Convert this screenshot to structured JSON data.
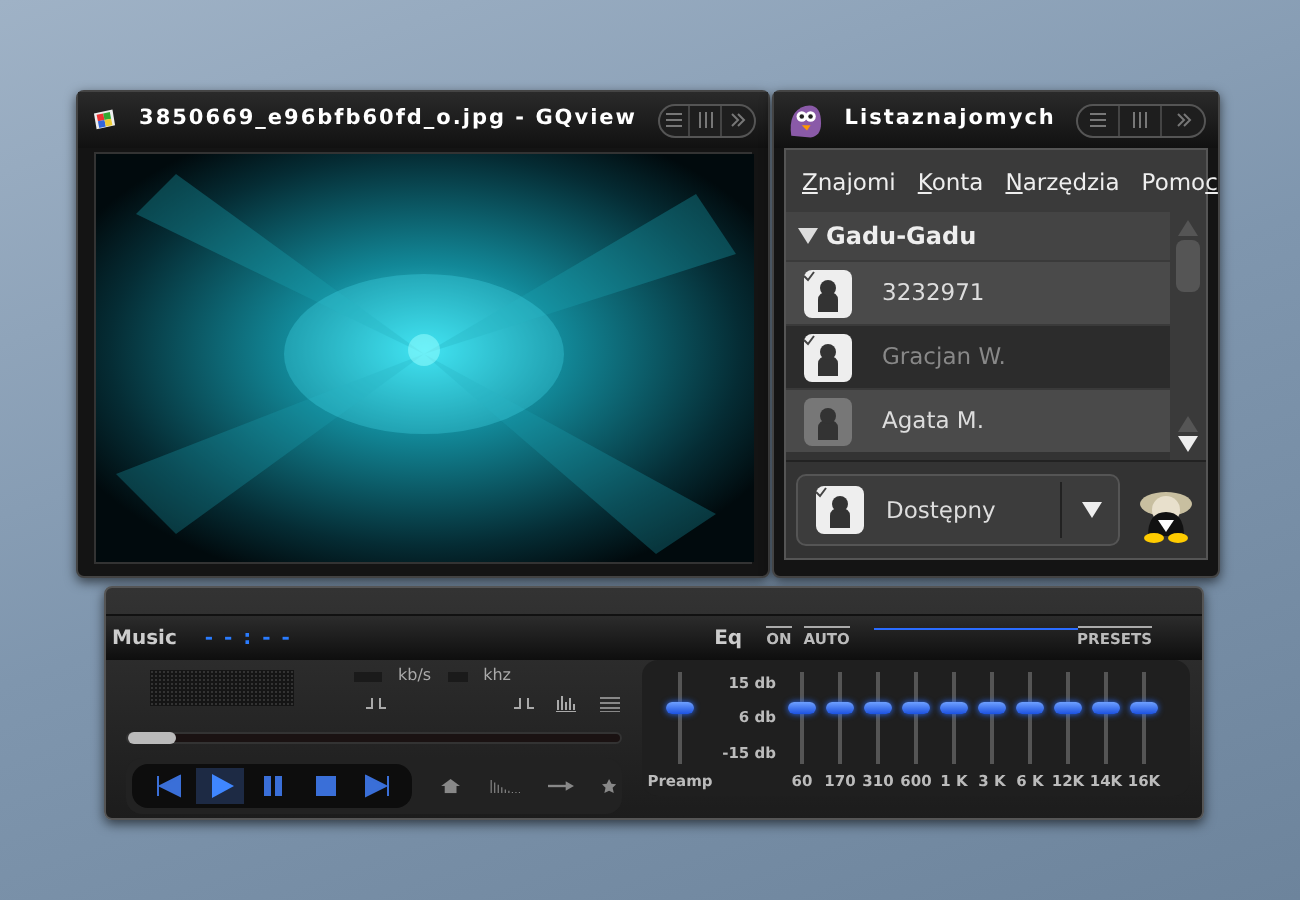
{
  "gqview": {
    "title": "3850669_e96bfb60fd_o.jpg - GQview"
  },
  "contacts": {
    "title": "Listaznajomych",
    "menu": [
      {
        "mnemonic": "Z",
        "rest": "najomi"
      },
      {
        "mnemonic": "K",
        "rest": "onta"
      },
      {
        "mnemonic": "N",
        "rest": "arzędzia"
      },
      {
        "lead": "Pomo",
        "mnemonic": "c"
      }
    ],
    "group": {
      "name": "Gadu-Gadu",
      "expanded": true
    },
    "items": [
      {
        "name": "3232971",
        "selected": false,
        "available": true
      },
      {
        "name": "Gracjan W.",
        "selected": true,
        "available": true
      },
      {
        "name": "Agata M.",
        "selected": false,
        "available": false
      }
    ],
    "status": {
      "label": "Dostępny",
      "available": true
    }
  },
  "player": {
    "music_label": "Music",
    "time": "- - : - -",
    "bitrate_unit": "kb/s",
    "rate_unit": "khz",
    "seek": {
      "level": 0
    },
    "eq": {
      "label": "Eq",
      "on": "ON",
      "auto": "AUTO",
      "presets": "PRESETS",
      "scale": [
        "15 db",
        "6 db",
        "-15 db"
      ],
      "preamp": {
        "label": "Preamp",
        "level": 0.62
      },
      "bands": [
        {
          "label": "60",
          "level": 0.62
        },
        {
          "label": "170",
          "level": 0.62
        },
        {
          "label": "310",
          "level": 0.62
        },
        {
          "label": "600",
          "level": 0.62
        },
        {
          "label": "1 K",
          "level": 0.62
        },
        {
          "label": "3 K",
          "level": 0.62
        },
        {
          "label": "6 K",
          "level": 0.62
        },
        {
          "label": "12K",
          "level": 0.62
        },
        {
          "label": "14K",
          "level": 0.62
        },
        {
          "label": "16K",
          "level": 0.62
        }
      ]
    }
  }
}
